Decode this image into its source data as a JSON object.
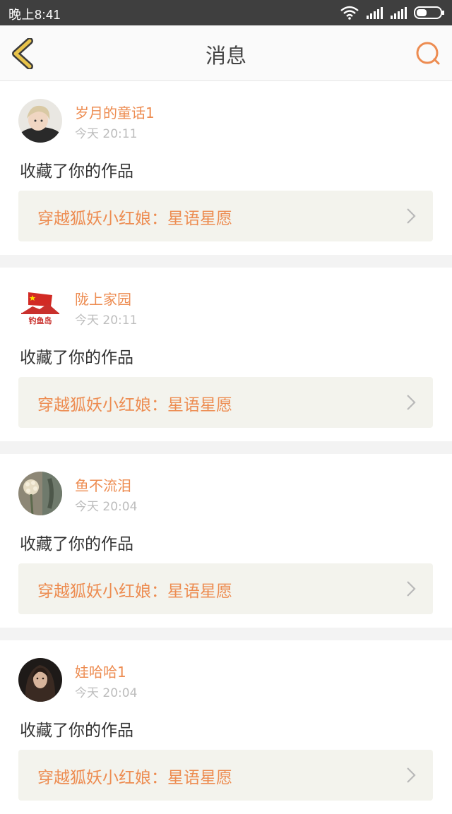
{
  "status_bar": {
    "time": "晚上8:41"
  },
  "header": {
    "title": "消息"
  },
  "colors": {
    "accent": "#ed8c51",
    "back_icon": "#e8c34a"
  },
  "messages": [
    {
      "user": "岁月的童话1",
      "time": "今天 20:11",
      "action": "收藏了你的作品",
      "work_title": "穿越狐妖小红娘：星语星愿",
      "avatar": "avatar-child-photo"
    },
    {
      "user": "陇上家园",
      "time": "今天 20:11",
      "action": "收藏了你的作品",
      "work_title": "穿越狐妖小红娘：星语星愿",
      "avatar": "avatar-flag-logo",
      "avatar_text": "钓鱼岛"
    },
    {
      "user": "鱼不流泪",
      "time": "今天 20:04",
      "action": "收藏了你的作品",
      "work_title": "穿越狐妖小红娘：星语星愿",
      "avatar": "avatar-flower-photo"
    },
    {
      "user": "娃哈哈1",
      "time": "今天 20:04",
      "action": "收藏了你的作品",
      "work_title": "穿越狐妖小红娘：星语星愿",
      "avatar": "avatar-girl-photo"
    }
  ]
}
